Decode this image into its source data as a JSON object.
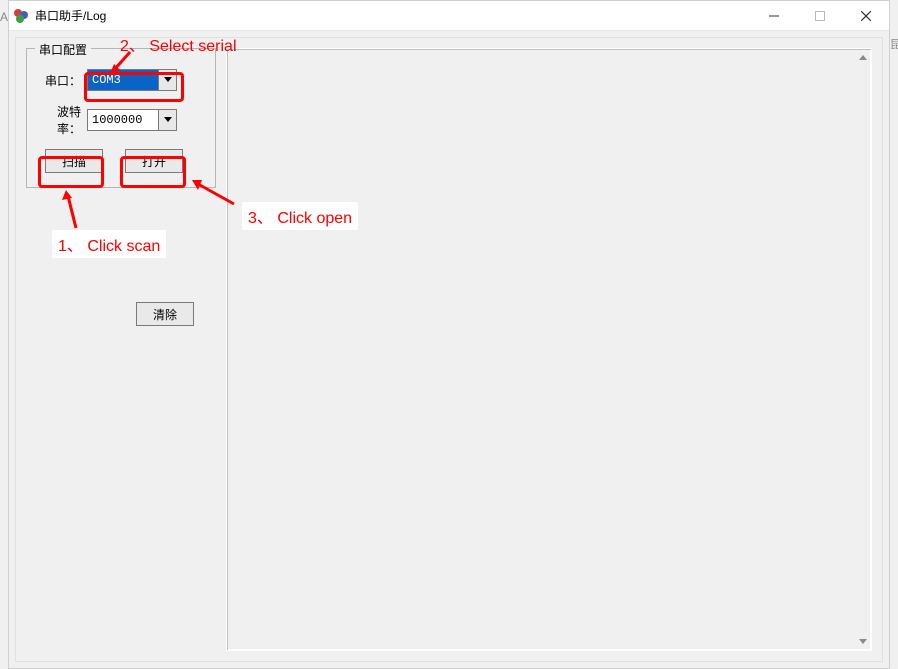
{
  "window": {
    "title": "串口助手/Log"
  },
  "serial_config": {
    "legend": "串口配置",
    "port_label": "串口：",
    "port_value": "COM3",
    "baud_label": "波特率：",
    "baud_value": "1000000",
    "scan_label": "扫描",
    "open_label": "打开"
  },
  "buttons": {
    "clear": "清除"
  },
  "annotations": {
    "step1": "1、 Click scan",
    "step2": "2、 Select serial",
    "step3": "3、 Click open"
  },
  "edge_chars": {
    "left": "A",
    "right": "昆"
  }
}
